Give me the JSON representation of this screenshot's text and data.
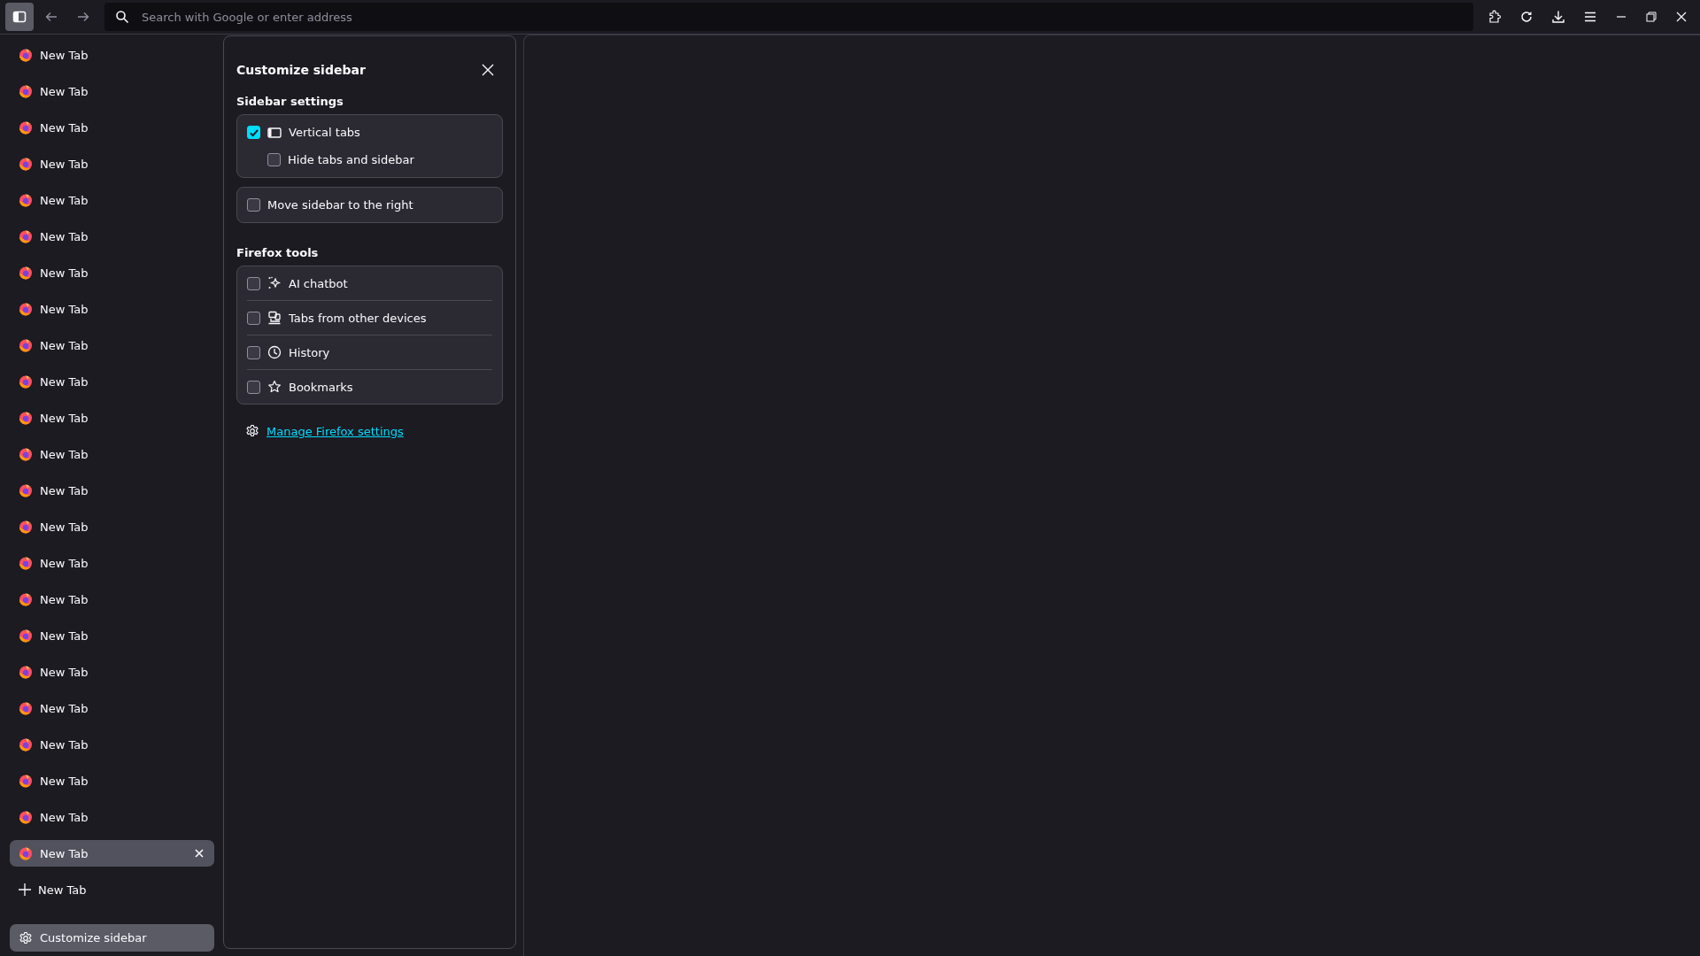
{
  "toolbar": {
    "address_placeholder": "Search with Google or enter address",
    "sidebar_toggle_selected": true
  },
  "tabs": [
    {
      "label": "New Tab",
      "selected": false
    },
    {
      "label": "New Tab",
      "selected": false
    },
    {
      "label": "New Tab",
      "selected": false
    },
    {
      "label": "New Tab",
      "selected": false
    },
    {
      "label": "New Tab",
      "selected": false
    },
    {
      "label": "New Tab",
      "selected": false
    },
    {
      "label": "New Tab",
      "selected": false
    },
    {
      "label": "New Tab",
      "selected": false
    },
    {
      "label": "New Tab",
      "selected": false
    },
    {
      "label": "New Tab",
      "selected": false
    },
    {
      "label": "New Tab",
      "selected": false
    },
    {
      "label": "New Tab",
      "selected": false
    },
    {
      "label": "New Tab",
      "selected": false
    },
    {
      "label": "New Tab",
      "selected": false
    },
    {
      "label": "New Tab",
      "selected": false
    },
    {
      "label": "New Tab",
      "selected": false
    },
    {
      "label": "New Tab",
      "selected": false
    },
    {
      "label": "New Tab",
      "selected": false
    },
    {
      "label": "New Tab",
      "selected": false
    },
    {
      "label": "New Tab",
      "selected": false
    },
    {
      "label": "New Tab",
      "selected": false
    },
    {
      "label": "New Tab",
      "selected": false
    },
    {
      "label": "New Tab",
      "selected": true
    }
  ],
  "new_tab": "New Tab",
  "customize_button": {
    "label": "Customize sidebar",
    "selected": true
  },
  "panel": {
    "title": "Customize sidebar",
    "sidebar_settings": {
      "heading": "Sidebar settings",
      "groups": [
        [
          {
            "label": "Vertical tabs",
            "checked": true,
            "kind": "vertical",
            "children": [
              {
                "label": "Hide tabs and sidebar",
                "checked": false
              }
            ]
          }
        ],
        [
          {
            "label": "Move sidebar to the right",
            "checked": false,
            "kind": "plain"
          }
        ]
      ]
    },
    "firefox_tools": {
      "heading": "Firefox tools",
      "items": [
        {
          "label": "AI chatbot",
          "checked": false,
          "kind": "chatbot"
        },
        {
          "label": "Tabs from other devices",
          "checked": false,
          "kind": "devices"
        },
        {
          "label": "History",
          "checked": false,
          "kind": "history"
        },
        {
          "label": "Bookmarks",
          "checked": false,
          "kind": "bookmarks"
        }
      ]
    },
    "settings_link": "Manage Firefox settings"
  }
}
